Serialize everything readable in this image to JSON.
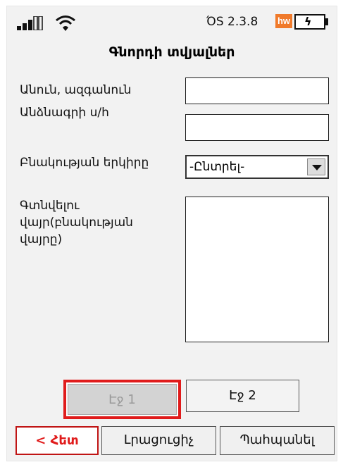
{
  "status": {
    "version": "ΌS 2.3.8",
    "badge": "hw",
    "battery_glyph": "ϟ"
  },
  "header": {
    "title": "Գնորդի տվյալներ"
  },
  "form": {
    "name_label": "Անուն, ազգանուն",
    "name_value": "",
    "passport_label": "Անձնագրի ս/հ",
    "passport_value": "",
    "country_label": "Բնակության երկիրը",
    "country_selected": "-Ընտրել-",
    "location_label": "Գտնվելու վայր(բնակության վայրը)",
    "location_value": ""
  },
  "pager": {
    "page1": "Էջ 1",
    "page2": "Էջ 2"
  },
  "actions": {
    "back": "< Հետ",
    "fill": "Լրացուցիչ",
    "save": "Պահպանել"
  },
  "colors": {
    "accent_red": "#e01b1b",
    "hw_orange": "#f07a2b"
  }
}
